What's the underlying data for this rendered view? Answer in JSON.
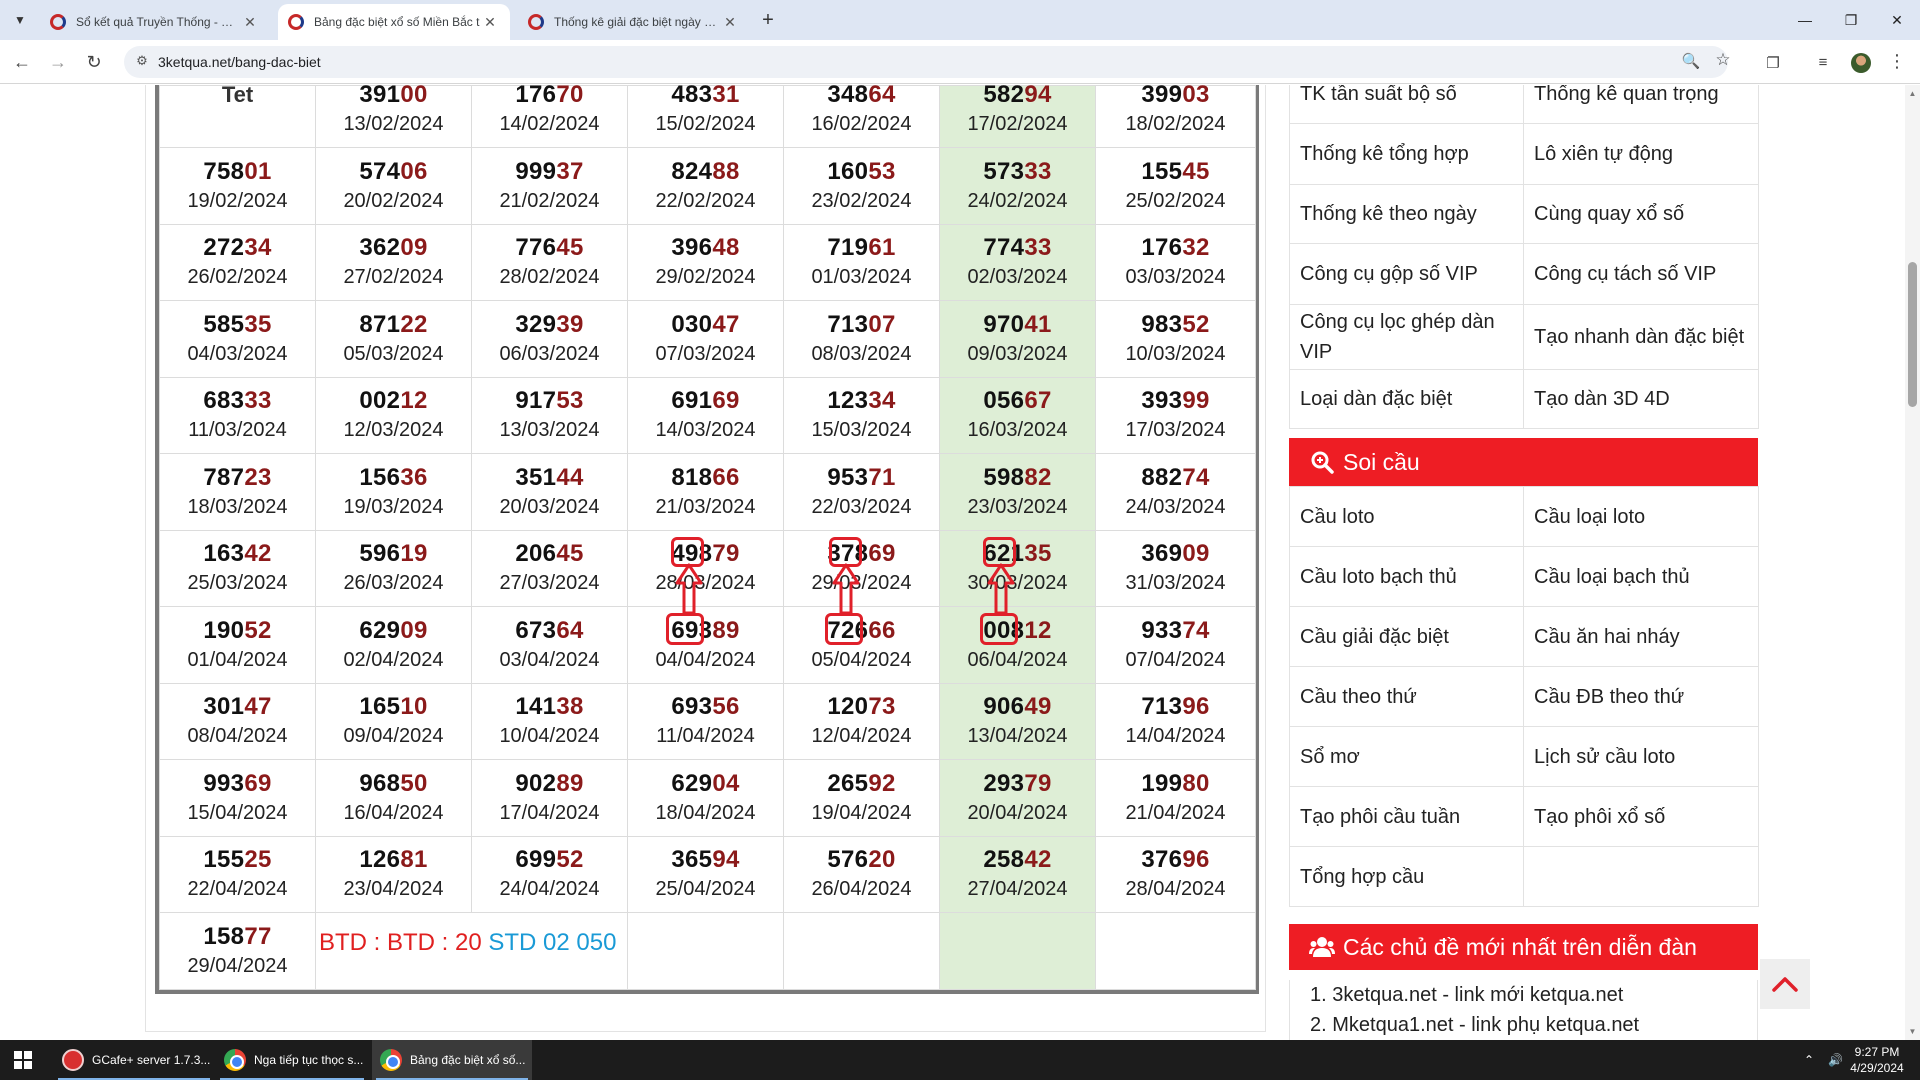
{
  "browser": {
    "tabs": [
      {
        "title": "Sổ kết quả Truyền Thống - Tổng",
        "active": false
      },
      {
        "title": "Bảng đặc biệt xổ số Miền Bắc t",
        "active": true
      },
      {
        "title": "Thống kê giải đặc biệt ngày hôm",
        "active": false
      }
    ],
    "url": "3ketqua.net/bang-dac-biet"
  },
  "table": {
    "first_row": [
      {
        "label": "Tet"
      },
      {
        "head": "391",
        "tail": "00",
        "date": "13/02/2024"
      },
      {
        "head": "176",
        "tail": "70",
        "date": "14/02/2024"
      },
      {
        "head": "483",
        "tail": "31",
        "date": "15/02/2024"
      },
      {
        "head": "348",
        "tail": "64",
        "date": "16/02/2024"
      },
      {
        "head": "582",
        "tail": "94",
        "date": "17/02/2024"
      },
      {
        "head": "399",
        "tail": "03",
        "date": "18/02/2024"
      }
    ],
    "rows": [
      [
        {
          "head": "758",
          "tail": "01",
          "date": "19/02/2024"
        },
        {
          "head": "574",
          "tail": "06",
          "date": "20/02/2024"
        },
        {
          "head": "999",
          "tail": "37",
          "date": "21/02/2024"
        },
        {
          "head": "824",
          "tail": "88",
          "date": "22/02/2024"
        },
        {
          "head": "160",
          "tail": "53",
          "date": "23/02/2024"
        },
        {
          "head": "573",
          "tail": "33",
          "date": "24/02/2024"
        },
        {
          "head": "155",
          "tail": "45",
          "date": "25/02/2024"
        }
      ],
      [
        {
          "head": "272",
          "tail": "34",
          "date": "26/02/2024"
        },
        {
          "head": "362",
          "tail": "09",
          "date": "27/02/2024"
        },
        {
          "head": "776",
          "tail": "45",
          "date": "28/02/2024"
        },
        {
          "head": "396",
          "tail": "48",
          "date": "29/02/2024"
        },
        {
          "head": "719",
          "tail": "61",
          "date": "01/03/2024"
        },
        {
          "head": "774",
          "tail": "33",
          "date": "02/03/2024"
        },
        {
          "head": "176",
          "tail": "32",
          "date": "03/03/2024"
        }
      ],
      [
        {
          "head": "585",
          "tail": "35",
          "date": "04/03/2024"
        },
        {
          "head": "871",
          "tail": "22",
          "date": "05/03/2024"
        },
        {
          "head": "329",
          "tail": "39",
          "date": "06/03/2024"
        },
        {
          "head": "030",
          "tail": "47",
          "date": "07/03/2024"
        },
        {
          "head": "713",
          "tail": "07",
          "date": "08/03/2024"
        },
        {
          "head": "970",
          "tail": "41",
          "date": "09/03/2024"
        },
        {
          "head": "983",
          "tail": "52",
          "date": "10/03/2024"
        }
      ],
      [
        {
          "head": "683",
          "tail": "33",
          "date": "11/03/2024"
        },
        {
          "head": "002",
          "tail": "12",
          "date": "12/03/2024"
        },
        {
          "head": "917",
          "tail": "53",
          "date": "13/03/2024"
        },
        {
          "head": "691",
          "tail": "69",
          "date": "14/03/2024"
        },
        {
          "head": "123",
          "tail": "34",
          "date": "15/03/2024"
        },
        {
          "head": "056",
          "tail": "67",
          "date": "16/03/2024"
        },
        {
          "head": "393",
          "tail": "99",
          "date": "17/03/2024"
        }
      ],
      [
        {
          "head": "787",
          "tail": "23",
          "date": "18/03/2024"
        },
        {
          "head": "156",
          "tail": "36",
          "date": "19/03/2024"
        },
        {
          "head": "351",
          "tail": "44",
          "date": "20/03/2024"
        },
        {
          "head": "818",
          "tail": "66",
          "date": "21/03/2024"
        },
        {
          "head": "953",
          "tail": "71",
          "date": "22/03/2024"
        },
        {
          "head": "598",
          "tail": "82",
          "date": "23/03/2024"
        },
        {
          "head": "882",
          "tail": "74",
          "date": "24/03/2024"
        }
      ],
      [
        {
          "head": "163",
          "tail": "42",
          "date": "25/03/2024"
        },
        {
          "head": "596",
          "tail": "19",
          "date": "26/03/2024"
        },
        {
          "head": "206",
          "tail": "45",
          "date": "27/03/2024"
        },
        {
          "head": "498",
          "tail": "79",
          "date": "28/03/2024"
        },
        {
          "head": "378",
          "tail": "69",
          "date": "29/03/2024"
        },
        {
          "head": "621",
          "tail": "35",
          "date": "30/03/2024"
        },
        {
          "head": "369",
          "tail": "09",
          "date": "31/03/2024"
        }
      ],
      [
        {
          "head": "190",
          "tail": "52",
          "date": "01/04/2024"
        },
        {
          "head": "629",
          "tail": "09",
          "date": "02/04/2024"
        },
        {
          "head": "673",
          "tail": "64",
          "date": "03/04/2024"
        },
        {
          "head": "693",
          "tail": "89",
          "date": "04/04/2024"
        },
        {
          "head": "726",
          "tail": "66",
          "date": "05/04/2024"
        },
        {
          "head": "008",
          "tail": "12",
          "date": "06/04/2024"
        },
        {
          "head": "933",
          "tail": "74",
          "date": "07/04/2024"
        }
      ],
      [
        {
          "head": "301",
          "tail": "47",
          "date": "08/04/2024"
        },
        {
          "head": "165",
          "tail": "10",
          "date": "09/04/2024"
        },
        {
          "head": "141",
          "tail": "38",
          "date": "10/04/2024"
        },
        {
          "head": "693",
          "tail": "56",
          "date": "11/04/2024"
        },
        {
          "head": "120",
          "tail": "73",
          "date": "12/04/2024"
        },
        {
          "head": "906",
          "tail": "49",
          "date": "13/04/2024"
        },
        {
          "head": "713",
          "tail": "96",
          "date": "14/04/2024"
        }
      ],
      [
        {
          "head": "993",
          "tail": "69",
          "date": "15/04/2024"
        },
        {
          "head": "968",
          "tail": "50",
          "date": "16/04/2024"
        },
        {
          "head": "902",
          "tail": "89",
          "date": "17/04/2024"
        },
        {
          "head": "629",
          "tail": "04",
          "date": "18/04/2024"
        },
        {
          "head": "265",
          "tail": "92",
          "date": "19/04/2024"
        },
        {
          "head": "293",
          "tail": "79",
          "date": "20/04/2024"
        },
        {
          "head": "199",
          "tail": "80",
          "date": "21/04/2024"
        }
      ],
      [
        {
          "head": "155",
          "tail": "25",
          "date": "22/04/2024"
        },
        {
          "head": "126",
          "tail": "81",
          "date": "23/04/2024"
        },
        {
          "head": "699",
          "tail": "52",
          "date": "24/04/2024"
        },
        {
          "head": "365",
          "tail": "94",
          "date": "25/04/2024"
        },
        {
          "head": "576",
          "tail": "20",
          "date": "26/04/2024"
        },
        {
          "head": "258",
          "tail": "42",
          "date": "27/04/2024"
        },
        {
          "head": "376",
          "tail": "96",
          "date": "28/04/2024"
        }
      ]
    ],
    "last_row": {
      "cell": {
        "head": "158",
        "tail": "77",
        "date": "29/04/2024"
      },
      "btd_text": "BTD : BTD : 20",
      "std_text": "STD 02 050"
    }
  },
  "sidebar": {
    "tools_grid": [
      [
        "TK tần suất bộ số",
        "Thống kê quan trọng"
      ],
      [
        "Thống kê tổng hợp",
        "Lô xiên tự động"
      ],
      [
        "Thống kê theo ngày",
        "Cùng quay xổ số"
      ],
      [
        "Công cụ gộp số VIP",
        "Công cụ tách số VIP"
      ],
      [
        "Công cụ lọc ghép dàn VIP",
        "Tạo nhanh dàn đặc biệt"
      ],
      [
        "Loại dàn đặc biệt",
        "Tạo dàn 3D 4D"
      ]
    ],
    "soi_cau_title": "Soi cầu",
    "soi_cau_grid": [
      [
        "Cầu loto",
        "Cầu loại loto"
      ],
      [
        "Cầu loto bạch thủ",
        "Cầu loại bạch thủ"
      ],
      [
        "Cầu giải đặc biệt",
        "Cầu ăn hai nháy"
      ],
      [
        "Cầu theo thứ",
        "Cầu ĐB theo thứ"
      ],
      [
        "Sổ mơ",
        "Lịch sử cầu loto"
      ],
      [
        "Tạo phôi cầu tuần",
        "Tạo phôi xổ số"
      ],
      [
        "Tổng hợp cầu",
        ""
      ]
    ],
    "forum_title": "Các chủ đề mới nhất trên diễn đàn",
    "forum_items": [
      "3ketqua.net - link mới ketqua.net",
      "Mketqua1.net - link phụ ketqua.net"
    ]
  },
  "taskbar": {
    "items": [
      {
        "label": "GCafe+ server 1.7.3...",
        "icon": "gcafe-icon"
      },
      {
        "label": "Nga tiếp tục thọc s...",
        "icon": "chrome-icon"
      },
      {
        "label": "Bảng đặc biệt xổ số...",
        "icon": "chrome-icon"
      }
    ],
    "time": "9:27 PM",
    "date": "4/29/2024"
  },
  "colors": {
    "tail_digits": "#8b1a1a",
    "weekend_column": "#deeed6",
    "sidebar_header": "#ee1d24",
    "btd_red": "#e02020",
    "std_blue": "#1a9ad6",
    "annotation": "#e0202a"
  },
  "icons": [
    "tab-search-icon",
    "favicon-icon",
    "close-icon",
    "new-tab-icon",
    "back-icon",
    "forward-icon",
    "reload-icon",
    "site-info-icon",
    "zoom-icon",
    "star-icon",
    "extensions-icon",
    "media-icon",
    "profile-icon",
    "menu-icon",
    "search-icon",
    "users-icon",
    "chevron-up-icon",
    "windows-start-icon"
  ]
}
